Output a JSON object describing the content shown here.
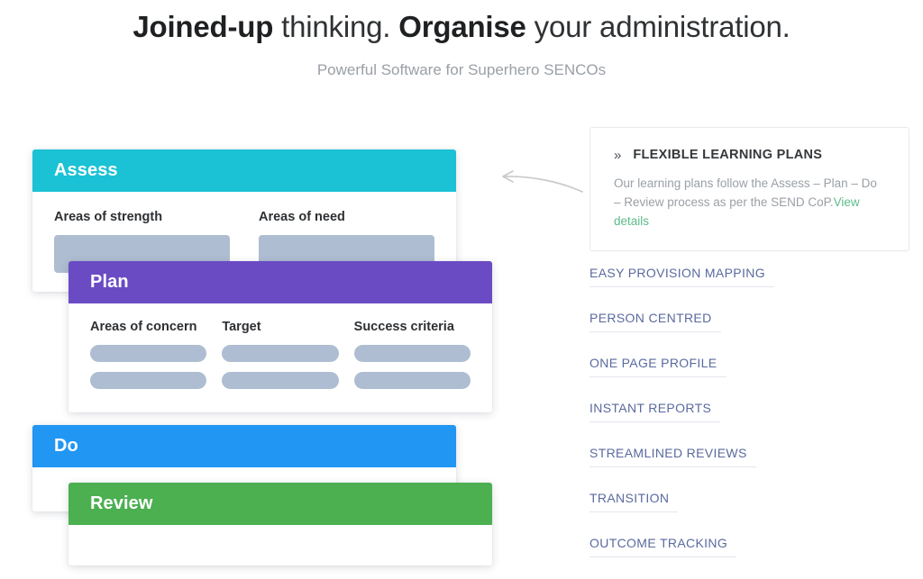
{
  "header": {
    "headline_part1": "Joined-up",
    "headline_part2": " thinking. ",
    "headline_part3": "Organise",
    "headline_part4": " your administration.",
    "subhead": "Powerful Software for Superhero SENCOs"
  },
  "mockup": {
    "cards": [
      {
        "id": "assess",
        "title": "Assess",
        "color": "#1bc2d5",
        "columns": [
          {
            "label": "Areas of strength",
            "placeholder_type": "block",
            "count": 1
          },
          {
            "label": "Areas of need",
            "placeholder_type": "block",
            "count": 1
          }
        ]
      },
      {
        "id": "plan",
        "title": "Plan",
        "color": "#6a4bc4",
        "columns": [
          {
            "label": "Areas of concern",
            "placeholder_type": "pill",
            "count": 2
          },
          {
            "label": "Target",
            "placeholder_type": "pill",
            "count": 2
          },
          {
            "label": "Success criteria",
            "placeholder_type": "pill",
            "count": 2
          }
        ]
      },
      {
        "id": "do",
        "title": "Do",
        "color": "#2196f3",
        "columns": []
      },
      {
        "id": "review",
        "title": "Review",
        "color": "#4caf50",
        "columns": []
      }
    ]
  },
  "connector": {
    "icon": "curved-arrow-left-icon",
    "color": "#c8cacd"
  },
  "features": {
    "card": {
      "chevron": "»",
      "title": "FLEXIBLE LEARNING PLANS",
      "description": "Our learning plans follow the Assess – Plan – Do – Review process as per the SEND CoP.",
      "link_label": "View details",
      "link_color": "#5cbc8a"
    },
    "items": [
      {
        "label": "EASY PROVISION MAPPING"
      },
      {
        "label": "PERSON CENTRED"
      },
      {
        "label": "ONE PAGE PROFILE"
      },
      {
        "label": "INSTANT REPORTS"
      },
      {
        "label": "STREAMLINED REVIEWS"
      },
      {
        "label": "TRANSITION"
      },
      {
        "label": "OUTCOME TRACKING"
      }
    ]
  }
}
